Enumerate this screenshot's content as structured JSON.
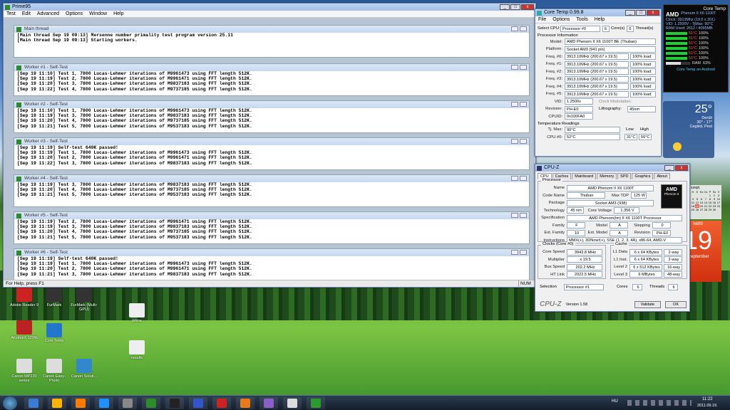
{
  "prime95": {
    "title": "Prime95",
    "menu": [
      "Test",
      "Edit",
      "Advanced",
      "Options",
      "Window",
      "Help"
    ],
    "main": {
      "title": "Main thread",
      "lines": [
        "",
        "[Main thread Sep 19 09:13] Mersenne number primality test program version 25.11",
        "[Main thread Sep 19 09:13] Starting workers."
      ]
    },
    "workers": [
      {
        "title": "Worker #1 - Self-Test",
        "lines": [
          "[Sep 19 11:10] Test 1, 7800 Lucas-Lehmer iterations of M9961473 using FFT length 512K.",
          "[Sep 19 11:19] Test 2, 7800 Lucas-Lehmer iterations of M9961471 using FFT length 512K.",
          "[Sep 19 11:20] Test 3, 7800 Lucas-Lehmer iterations of M9837183 using FFT length 512K.",
          "[Sep 19 11:22] Test 4, 7800 Lucas-Lehmer iterations of M9737185 using FFT length 512K."
        ]
      },
      {
        "title": "Worker #2 - Self-Test",
        "lines": [
          "[Sep 19 11:10] Test 1, 7800 Lucas-Lehmer iterations of M9961473 using FFT length 512K.",
          "[Sep 19 11:19] Test 3, 7800 Lucas-Lehmer iterations of M9837183 using FFT length 512K.",
          "[Sep 19 11:20] Test 4, 7800 Lucas-Lehmer iterations of M9737185 using FFT length 512K.",
          "[Sep 19 11:21] Test 5, 7800 Lucas-Lehmer iterations of M9537183 using FFT length 512K."
        ]
      },
      {
        "title": "Worker #3 - Self-Test",
        "lines": [
          "[Sep 19 11:19] Self-test 640K passed!",
          "[Sep 19 11:19] Test 1, 7800 Lucas-Lehmer iterations of M9961473 using FFT length 512K.",
          "[Sep 19 11:20] Test 2, 7800 Lucas-Lehmer iterations of M9961471 using FFT length 512K.",
          "[Sep 19 11:22] Test 3, 7800 Lucas-Lehmer iterations of M9837183 using FFT length 512K."
        ]
      },
      {
        "title": "Worker #4 - Self-Test",
        "lines": [
          "[Sep 19 11:19] Test 3, 7800 Lucas-Lehmer iterations of M9837183 using FFT length 512K.",
          "[Sep 19 11:20] Test 4, 7800 Lucas-Lehmer iterations of M9737185 using FFT length 512K.",
          "[Sep 19 11:21] Test 5, 7800 Lucas-Lehmer iterations of M9537183 using FFT length 512K."
        ]
      },
      {
        "title": "Worker #5 - Self-Test",
        "lines": [
          "[Sep 19 11:19] Test 2, 7800 Lucas-Lehmer iterations of M9961471 using FFT length 512K.",
          "[Sep 19 11:19] Test 3, 7800 Lucas-Lehmer iterations of M9837183 using FFT length 512K.",
          "[Sep 19 11:20] Test 4, 7800 Lucas-Lehmer iterations of M9737185 using FFT length 512K.",
          "[Sep 19 11:21] Test 5, 7800 Lucas-Lehmer iterations of M9537183 using FFT length 512K."
        ]
      },
      {
        "title": "Worker #6 - Self-Test",
        "lines": [
          "[Sep 19 11:19] Self-test 640K passed!",
          "[Sep 19 11:19] Test 1, 7800 Lucas-Lehmer iterations of M9961473 using FFT length 512K.",
          "[Sep 19 11:20] Test 2, 7800 Lucas-Lehmer iterations of M9961471 using FFT length 512K.",
          "[Sep 19 11:21] Test 3, 7800 Lucas-Lehmer iterations of M9837183 using FFT length 512K."
        ]
      }
    ],
    "status": "For Help, press F1",
    "num": "NUM"
  },
  "coretemp": {
    "title": "Core Temp 0.99.8",
    "menu": [
      "File",
      "Options",
      "Tools",
      "Help"
    ],
    "select_cpu": "Select CPU:",
    "processor": "Processor #0",
    "cores_n": "6",
    "cores": "Core(s)",
    "threads_n": "6",
    "threads": "Thread(s)",
    "info": "Processor Information",
    "model_l": "Model:",
    "model": "AMD Phenom II X6 1100T BE (Thuban)",
    "platform_l": "Platform:",
    "platform": "Socket AM3 (941 pin)",
    "freqs": [
      {
        "l": "Freq. #0:",
        "v": "3913.10MHz (200.67 x 19.5)",
        "load": "100% load"
      },
      {
        "l": "Freq. #1:",
        "v": "3913.10MHz (200.67 x 19.5)",
        "load": "100% load"
      },
      {
        "l": "Freq. #2:",
        "v": "3913.10MHz (200.67 x 19.5)",
        "load": "100% load"
      },
      {
        "l": "Freq. #3:",
        "v": "3913.10MHz (200.67 x 19.5)",
        "load": "100% load"
      },
      {
        "l": "Freq. #4:",
        "v": "3913.10MHz (200.67 x 19.5)",
        "load": "100% load"
      },
      {
        "l": "Freq. #5:",
        "v": "3913.10MHz (200.67 x 19.5)",
        "load": "100% load"
      }
    ],
    "vid_l": "VID:",
    "vid": "1.2500v",
    "mod_l": "Clock Modulation:",
    "rev_l": "Revision:",
    "rev": "PH-E0",
    "lith_l": "Lithography:",
    "lith": "45nm",
    "cpuid_l": "CPUID:",
    "cpuid": "0x100FA0",
    "readings": "Temperature Readings",
    "tjmax_l": "Tj. Max:",
    "tjmax": "90°C",
    "low": "Low",
    "high": "High",
    "cpu0_l": "CPU #0:",
    "cpu0": "52°C",
    "cpu0_low": "31°C",
    "cpu0_high": "56°C"
  },
  "gadget": {
    "title": "Core Temp",
    "cpu": "Phenom II X6 1100T",
    "clock": "Clock: 3913Mhz (19.5 x 201)",
    "vid": "VID: 1.2500V - TjMax: 90°C",
    "ram": "RAM Used: 2612 / 4095MB",
    "ram_label": "RAM",
    "ram_pct": "63%",
    "cores": [
      {
        "t": "51°C",
        "l": "100%"
      },
      {
        "t": "51°C",
        "l": "100%"
      },
      {
        "t": "51°C",
        "l": "100%"
      },
      {
        "t": "51°C",
        "l": "100%"
      },
      {
        "t": "51°C",
        "l": "100%"
      },
      {
        "t": "51°C",
        "l": "100%"
      }
    ],
    "android": "Core Temp on Android",
    "bar_color": "#22cc33"
  },
  "weather": {
    "temp": "25°",
    "desc": "Derült",
    "range": "30° - 17°",
    "city": "Cegléd, Pest"
  },
  "cpuz": {
    "title": "CPU-Z",
    "tabs": [
      "CPU",
      "Caches",
      "Mainboard",
      "Memory",
      "SPD",
      "Graphics",
      "About"
    ],
    "processor_grp": "Processor",
    "name_l": "Name",
    "name": "AMD Phenom II X6 1100T",
    "codename_l": "Code Name",
    "codename": "Thuban",
    "tdp_l": "Max TDP",
    "tdp": "125 W",
    "package_l": "Package",
    "package": "Socket AM3 (938)",
    "tech_l": "Technology",
    "tech": "45 nm",
    "voltage_l": "Core Voltage",
    "voltage": "1.356 V",
    "spec_l": "Specification",
    "spec": "AMD Phenom(tm) II X6 1100T Processor",
    "family_l": "Family",
    "family": "F",
    "model_l": "Model",
    "model": "A",
    "stepping_l": "Stepping",
    "stepping": "0",
    "extfam_l": "Ext. Family",
    "extfam": "10",
    "extmod_l": "Ext. Model",
    "extmod": "A",
    "rev_l": "Revision",
    "rev": "PH-E0",
    "instr_l": "Instructions",
    "instr": "MMX(+), 3DNow!(+), SSE (1, 2, 3, 4A), x86-64, AMD-V",
    "clocks_grp": "Clocks (Core #0)",
    "speed_l": "Core Speed",
    "speed": "3943.8 MHz",
    "mult_l": "Multiplier",
    "mult": "x 19.5",
    "bus_l": "Bus Speed",
    "bus": "202.2 MHz",
    "ht_l": "HT Link",
    "ht": "2022.5 MHz",
    "cache_grp": "Cache",
    "l1d_l": "L1 Data",
    "l1d": "6 x 64 KBytes",
    "l1d_w": "2-way",
    "l1i_l": "L1 Inst.",
    "l1i": "6 x 64 KBytes",
    "l1i_w": "2-way",
    "l2_l": "Level 2",
    "l2": "6 x 512 KBytes",
    "l2_w": "16-way",
    "l3_l": "Level 3",
    "l3": "6 MBytes",
    "l3_w": "48-way",
    "selection_l": "Selection",
    "selection": "Processor #1",
    "cores_l": "Cores",
    "cores": "6",
    "threads_l": "Threads",
    "threads": "6",
    "brand": "CPU-Z",
    "version": "Version 1.58",
    "validate": "Validate",
    "ok": "OK",
    "logo_text": "AMD",
    "logo_sub": "Phenom II"
  },
  "calendar": {
    "day": "19",
    "month": "szeptember",
    "weekday": "hétfő",
    "head": "szept.",
    "dow": [
      "H",
      "K",
      "Sz",
      "Cs",
      "P",
      "Sz",
      "V"
    ],
    "days": [
      "",
      "",
      "",
      "",
      "1",
      "2",
      "3",
      "4",
      "5",
      "6",
      "7",
      "8",
      "9",
      "10",
      "11",
      "12",
      "13",
      "14",
      "15",
      "16",
      "17",
      "18",
      "19",
      "20",
      "21",
      "22",
      "23",
      "24",
      "25",
      "26",
      "27",
      "28",
      "29",
      "30"
    ]
  },
  "desktop_icons": [
    {
      "label": "Adobe Reader 9",
      "color": "#c22"
    },
    {
      "label": "FurMark",
      "color": "#333"
    },
    {
      "label": "FurMark (Multi-GPU)",
      "color": "#333"
    },
    {
      "label": "AlcoholX 120%",
      "color": "#b22"
    },
    {
      "label": "Core Temp",
      "color": "#27c"
    },
    {
      "label": "prime",
      "color": "#eee"
    },
    {
      "label": "results",
      "color": "#eee"
    },
    {
      "label": "Canon MP220 series",
      "color": "#ddd"
    },
    {
      "label": "Canon Easy-Photo",
      "color": "#ddd"
    },
    {
      "label": "Canon Soluti...",
      "color": "#38c"
    }
  ],
  "taskbar": {
    "lang": "HU",
    "time": "11:22",
    "date": "2011.09.19.",
    "apps": [
      "#3a7bd5",
      "#ffb400",
      "#ff7a00",
      "#1e90ff",
      "#888",
      "#2c8c2c",
      "#222",
      "#3355cc",
      "#cc2222",
      "#e87a1a",
      "#8a5fc9",
      "#dddddd",
      "#2d9a2d"
    ]
  }
}
